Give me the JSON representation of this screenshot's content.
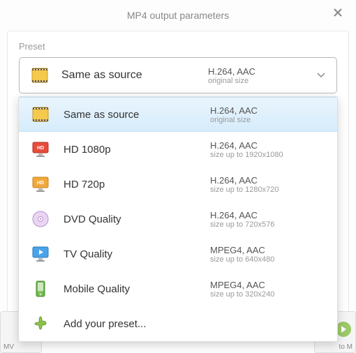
{
  "dialog": {
    "title": "MP4 output parameters",
    "preset_label": "Preset"
  },
  "selected": {
    "label": "Same as source",
    "codec": "H.264, AAC",
    "size": "original size"
  },
  "options": [
    {
      "label": "Same as source",
      "codec": "H.264, AAC",
      "size": "original size",
      "icon": "film"
    },
    {
      "label": "HD 1080p",
      "codec": "H.264, AAC",
      "size": "size up to 1920x1080",
      "icon": "monitor-red"
    },
    {
      "label": "HD 720p",
      "codec": "H.264, AAC",
      "size": "size up to 1280x720",
      "icon": "monitor-orange"
    },
    {
      "label": "DVD Quality",
      "codec": "H.264, AAC",
      "size": "size up to 720x576",
      "icon": "disc"
    },
    {
      "label": "TV Quality",
      "codec": "MPEG4, AAC",
      "size": "size up to 640x480",
      "icon": "monitor-blue"
    },
    {
      "label": "Mobile Quality",
      "codec": "MPEG4, AAC",
      "size": "size up to 320x240",
      "icon": "phone"
    }
  ],
  "add_preset_label": "Add your preset...",
  "bg": {
    "left": "MV",
    "right": "to M"
  }
}
